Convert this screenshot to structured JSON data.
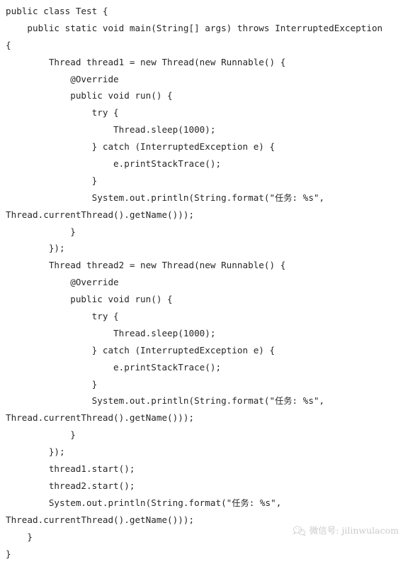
{
  "document": {
    "type": "code-screenshot",
    "language": "java",
    "background_color": "#ffffff",
    "text_color": "#262626"
  },
  "code": {
    "lines": [
      "public class Test {",
      "    public static void main(String[] args) throws InterruptedException",
      "{",
      "        Thread thread1 = new Thread(new Runnable() {",
      "            @Override",
      "            public void run() {",
      "                try {",
      "                    Thread.sleep(1000);",
      "                } catch (InterruptedException e) {",
      "                    e.printStackTrace();",
      "                }",
      "                System.out.println(String.format(\"任务: %s\",",
      "Thread.currentThread().getName()));",
      "            }",
      "        });",
      "        Thread thread2 = new Thread(new Runnable() {",
      "            @Override",
      "            public void run() {",
      "                try {",
      "                    Thread.sleep(1000);",
      "                } catch (InterruptedException e) {",
      "                    e.printStackTrace();",
      "                }",
      "                System.out.println(String.format(\"任务: %s\",",
      "Thread.currentThread().getName()));",
      "            }",
      "        });",
      "        thread1.start();",
      "        thread2.start();",
      "        System.out.println(String.format(\"任务: %s\",",
      "Thread.currentThread().getName()));",
      "    }",
      "}"
    ]
  },
  "watermark": {
    "icon": "wechat-icon",
    "label_cjk": "微信号",
    "separator": ": ",
    "account": "jilinwulacom",
    "full_text": "微信号: jilinwulacom",
    "color": "#9a9a9a"
  }
}
